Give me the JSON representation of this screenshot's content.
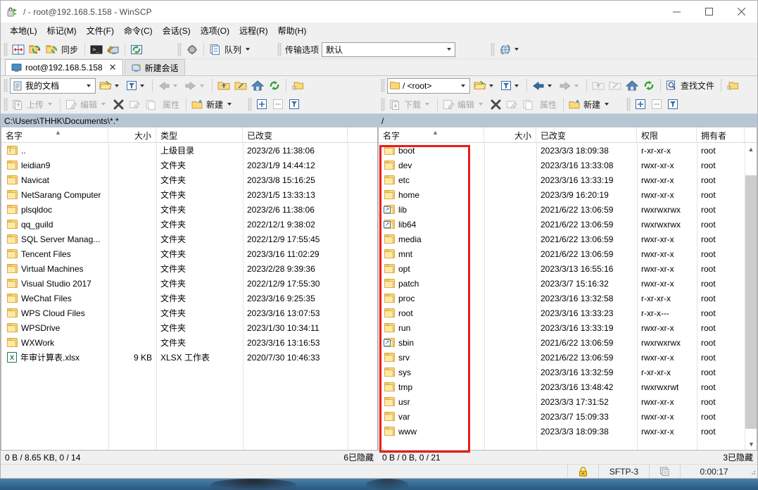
{
  "window": {
    "title": "/ - root@192.168.5.158 - WinSCP",
    "minimize": "—",
    "maximize": "□",
    "close": "✕"
  },
  "menubar": [
    {
      "label": "本地(L)"
    },
    {
      "label": "标记(M)"
    },
    {
      "label": "文件(F)"
    },
    {
      "label": "命令(C)"
    },
    {
      "label": "会话(S)"
    },
    {
      "label": "选项(O)"
    },
    {
      "label": "远程(R)"
    },
    {
      "label": "帮助(H)"
    }
  ],
  "toolbar": {
    "sync_label": "同步",
    "queue_label": "队列",
    "transfer_options_label": "传输选项",
    "transfer_options_value": "默认"
  },
  "tabs": [
    {
      "label": "root@192.168.5.158",
      "close": "✕",
      "active": true
    },
    {
      "label": "新建会话",
      "active": false
    }
  ],
  "local": {
    "path_combo": "我的文档",
    "path_bar": "C:\\Users\\THHK\\Documents\\*.*",
    "buttons": {
      "upload": "上传",
      "edit": "编辑",
      "properties": "属性",
      "new": "新建"
    },
    "columns": [
      {
        "key": "name",
        "label": "名字",
        "align": "left"
      },
      {
        "key": "size",
        "label": "大小",
        "align": "right"
      },
      {
        "key": "type",
        "label": "类型",
        "align": "left"
      },
      {
        "key": "changed",
        "label": "已改变",
        "align": "left"
      }
    ],
    "rows": [
      {
        "icon": "parent-folder-icon",
        "name": "..",
        "size": "",
        "type": "上级目录",
        "changed": "2023/2/6   11:38:06"
      },
      {
        "icon": "folder-icon",
        "name": "leidian9",
        "size": "",
        "type": "文件夹",
        "changed": "2023/1/9   14:44:12"
      },
      {
        "icon": "folder-icon",
        "name": "Navicat",
        "size": "",
        "type": "文件夹",
        "changed": "2023/3/8   15:16:25"
      },
      {
        "icon": "folder-icon",
        "name": "NetSarang Computer",
        "size": "",
        "type": "文件夹",
        "changed": "2023/1/5   13:33:13"
      },
      {
        "icon": "folder-icon",
        "name": "plsqldoc",
        "size": "",
        "type": "文件夹",
        "changed": "2023/2/6   11:38:06"
      },
      {
        "icon": "folder-icon",
        "name": "qq_guild",
        "size": "",
        "type": "文件夹",
        "changed": "2022/12/1   9:38:02"
      },
      {
        "icon": "folder-icon",
        "name": "SQL Server Manag...",
        "size": "",
        "type": "文件夹",
        "changed": "2022/12/9   17:55:45"
      },
      {
        "icon": "folder-icon",
        "name": "Tencent Files",
        "size": "",
        "type": "文件夹",
        "changed": "2023/3/16   11:02:29"
      },
      {
        "icon": "folder-icon",
        "name": "Virtual Machines",
        "size": "",
        "type": "文件夹",
        "changed": "2023/2/28   9:39:36"
      },
      {
        "icon": "folder-icon",
        "name": "Visual Studio 2017",
        "size": "",
        "type": "文件夹",
        "changed": "2022/12/9   17:55:30"
      },
      {
        "icon": "folder-icon",
        "name": "WeChat Files",
        "size": "",
        "type": "文件夹",
        "changed": "2023/3/16   9:25:35"
      },
      {
        "icon": "folder-icon",
        "name": "WPS Cloud Files",
        "size": "",
        "type": "文件夹",
        "changed": "2023/3/16   13:07:53"
      },
      {
        "icon": "folder-icon",
        "name": "WPSDrive",
        "size": "",
        "type": "文件夹",
        "changed": "2023/1/30   10:34:11"
      },
      {
        "icon": "folder-icon",
        "name": "WXWork",
        "size": "",
        "type": "文件夹",
        "changed": "2023/3/16   13:16:53"
      },
      {
        "icon": "xlsx-file-icon",
        "name": "年审计算表.xlsx",
        "size": "9 KB",
        "type": "XLSX 工作表",
        "changed": "2020/7/30   10:46:33"
      }
    ],
    "status_left": "0 B / 8.65 KB,  0 / 14",
    "status_right": "6已隐藏"
  },
  "remote": {
    "path_combo": "/ <root>",
    "path_bar": "/",
    "find_files_label": "查找文件",
    "buttons": {
      "download": "下载",
      "edit": "编辑",
      "properties": "属性",
      "new": "新建"
    },
    "columns": [
      {
        "key": "name",
        "label": "名字",
        "align": "left"
      },
      {
        "key": "size",
        "label": "大小",
        "align": "right"
      },
      {
        "key": "changed",
        "label": "已改变",
        "align": "left"
      },
      {
        "key": "perms",
        "label": "权限",
        "align": "left"
      },
      {
        "key": "owner",
        "label": "拥有者",
        "align": "left"
      }
    ],
    "rows": [
      {
        "icon": "folder-icon",
        "name": "boot",
        "size": "",
        "changed": "2023/3/3 18:09:38",
        "perms": "r-xr-xr-x",
        "owner": "root"
      },
      {
        "icon": "folder-icon",
        "name": "dev",
        "size": "",
        "changed": "2023/3/16 13:33:08",
        "perms": "rwxr-xr-x",
        "owner": "root"
      },
      {
        "icon": "folder-icon",
        "name": "etc",
        "size": "",
        "changed": "2023/3/16 13:33:19",
        "perms": "rwxr-xr-x",
        "owner": "root"
      },
      {
        "icon": "folder-icon",
        "name": "home",
        "size": "",
        "changed": "2023/3/9 16:20:19",
        "perms": "rwxr-xr-x",
        "owner": "root"
      },
      {
        "icon": "symlink-folder-icon",
        "name": "lib",
        "size": "",
        "changed": "2021/6/22 13:06:59",
        "perms": "rwxrwxrwx",
        "owner": "root"
      },
      {
        "icon": "symlink-folder-icon",
        "name": "lib64",
        "size": "",
        "changed": "2021/6/22 13:06:59",
        "perms": "rwxrwxrwx",
        "owner": "root"
      },
      {
        "icon": "folder-icon",
        "name": "media",
        "size": "",
        "changed": "2021/6/22 13:06:59",
        "perms": "rwxr-xr-x",
        "owner": "root"
      },
      {
        "icon": "folder-icon",
        "name": "mnt",
        "size": "",
        "changed": "2021/6/22 13:06:59",
        "perms": "rwxr-xr-x",
        "owner": "root"
      },
      {
        "icon": "folder-icon",
        "name": "opt",
        "size": "",
        "changed": "2023/3/13 16:55:16",
        "perms": "rwxr-xr-x",
        "owner": "root"
      },
      {
        "icon": "folder-icon",
        "name": "patch",
        "size": "",
        "changed": "2023/3/7 15:16:32",
        "perms": "rwxr-xr-x",
        "owner": "root"
      },
      {
        "icon": "folder-icon",
        "name": "proc",
        "size": "",
        "changed": "2023/3/16 13:32:58",
        "perms": "r-xr-xr-x",
        "owner": "root"
      },
      {
        "icon": "folder-icon",
        "name": "root",
        "size": "",
        "changed": "2023/3/16 13:33:23",
        "perms": "r-xr-x---",
        "owner": "root"
      },
      {
        "icon": "folder-icon",
        "name": "run",
        "size": "",
        "changed": "2023/3/16 13:33:19",
        "perms": "rwxr-xr-x",
        "owner": "root"
      },
      {
        "icon": "symlink-folder-icon",
        "name": "sbin",
        "size": "",
        "changed": "2021/6/22 13:06:59",
        "perms": "rwxrwxrwx",
        "owner": "root"
      },
      {
        "icon": "folder-icon",
        "name": "srv",
        "size": "",
        "changed": "2021/6/22 13:06:59",
        "perms": "rwxr-xr-x",
        "owner": "root"
      },
      {
        "icon": "folder-icon",
        "name": "sys",
        "size": "",
        "changed": "2023/3/16 13:32:59",
        "perms": "r-xr-xr-x",
        "owner": "root"
      },
      {
        "icon": "folder-icon",
        "name": "tmp",
        "size": "",
        "changed": "2023/3/16 13:48:42",
        "perms": "rwxrwxrwt",
        "owner": "root"
      },
      {
        "icon": "folder-icon",
        "name": "usr",
        "size": "",
        "changed": "2023/3/3 17:31:52",
        "perms": "rwxr-xr-x",
        "owner": "root"
      },
      {
        "icon": "folder-icon",
        "name": "var",
        "size": "",
        "changed": "2023/3/7 15:09:33",
        "perms": "rwxr-xr-x",
        "owner": "root"
      },
      {
        "icon": "folder-icon",
        "name": "www",
        "size": "",
        "changed": "2023/3/3 18:09:38",
        "perms": "rwxr-xr-x",
        "owner": "root"
      }
    ],
    "status_left": "0 B / 0 B,  0 / 21",
    "status_right": "3已隐藏"
  },
  "statusbar": {
    "protocol": "SFTP-3",
    "elapsed": "0:00:17"
  },
  "annotation": {
    "highlight_color": "#ee1b1b"
  }
}
